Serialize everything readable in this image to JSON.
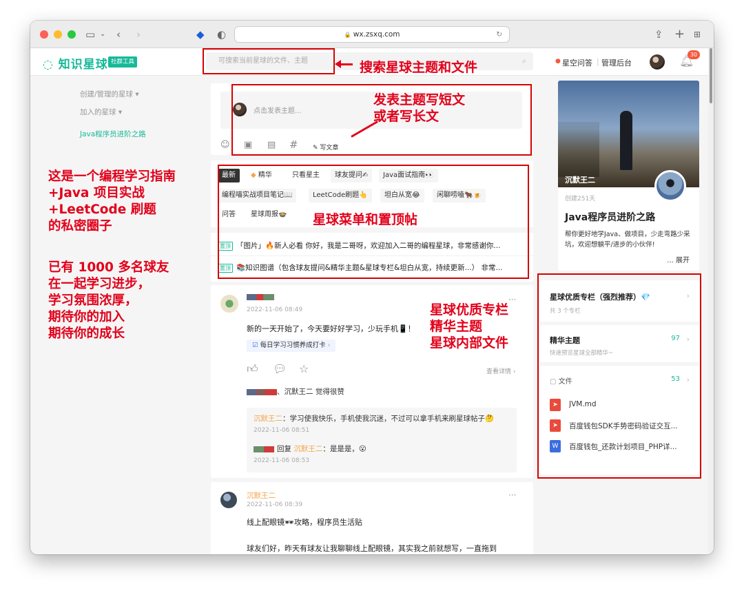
{
  "browser": {
    "url": "wx.zsxq.com"
  },
  "header": {
    "logo": "知识星球",
    "logo_tag": "社群工具",
    "search_placeholder": "可搜索当前星球的文件、主题",
    "qa_link": "星空问答",
    "admin_link": "管理后台",
    "notification_count": "30"
  },
  "left_nav": {
    "items": [
      "创建/管理的星球 ▾",
      "加入的星球 ▾"
    ],
    "active": "Java程序员进阶之路"
  },
  "left_annotation": {
    "lines1": [
      "这是一个编程学习指南",
      "+Java 项目实战",
      "+LeetCode 刷题",
      "的私密圈子"
    ],
    "lines2": [
      "已有 1000 多名球友",
      "在一起学习进步，",
      "学习氛围浓厚，",
      "期待你的加入",
      "期待你的成长"
    ]
  },
  "annotations": {
    "search": "搜索星球主题和文件",
    "post": [
      "发表主题写短文",
      "或者写长文"
    ],
    "menu": "星球菜单和置顶帖",
    "sidebar": [
      "星球优质专栏",
      "精华主题",
      "星球内部文件"
    ]
  },
  "composer": {
    "placeholder": "点击发表主题...",
    "write_article": "写文章"
  },
  "menu": {
    "row1": [
      "最新",
      "精华",
      "只看星主",
      "球友提问✍",
      "Java面试指南👀"
    ],
    "row2": [
      "编程喵实战项目笔记📖",
      "LeetCode刷题👆",
      "坦白从宽😂",
      "闲聊唠嗑🐂🍺"
    ],
    "row3": [
      "问答",
      "星球周报🍲"
    ]
  },
  "pinned": [
    {
      "tag": "置顶",
      "text": "「图片」🔥新人必看 你好，我是二哥呀，欢迎加入二哥的编程星球，非常感谢你..."
    },
    {
      "tag": "置顶",
      "text": "📚知识图谱（包含球友提问&精华主题&星球专栏&坦白从宽，持续更新...） 非常..."
    }
  ],
  "post1": {
    "time": "2022-11-06 08:49",
    "text": "新的一天开始了，今天要好好学习，少玩手机📱！",
    "tag": "每日学习习惯养成打卡",
    "view_detail": "查看详情",
    "likes_suffix": "、沉默王二 觉得很赞",
    "comments": [
      {
        "author": "沉默王二",
        "text": "：学习使我快乐，手机使我沉迷，不过可以拿手机来刷星球帖子🤔",
        "time": "2022-11-06 08:51"
      },
      {
        "author": "沉默王二",
        "prefix": "回复 ",
        "text": "：是是是，😮",
        "time": "2022-11-06 08:53"
      }
    ]
  },
  "post2": {
    "author": "沉默王二",
    "time": "2022-11-06 08:39",
    "title": "线上配眼镜🕶攻略，程序员生活贴",
    "text": "球友们好，昨天有球友让我聊聊线上配眼镜，其实我之前就想写，一直拖到"
  },
  "sidebar": {
    "owner_name": "沉默王二",
    "created": "创建251天",
    "planet_name": "Java程序员进阶之路",
    "desc": "帮你更好地学Java、做项目，少走弯路少采坑，欢迎想躺平/进步的小伙伴!",
    "expand": "... 展开",
    "column_title": "星球优质专栏（强烈推荐）💎",
    "column_sub": "共 3 个专栏",
    "essence_title": "精华主题",
    "essence_sub": "快速预览星球全部精华~",
    "essence_count": "97",
    "files_title": "文件",
    "files_count": "53",
    "files": [
      "JVM.md",
      "百度钱包SDK手势密码验证交互...",
      "百度钱包_还款计划项目_PHP详..."
    ]
  }
}
